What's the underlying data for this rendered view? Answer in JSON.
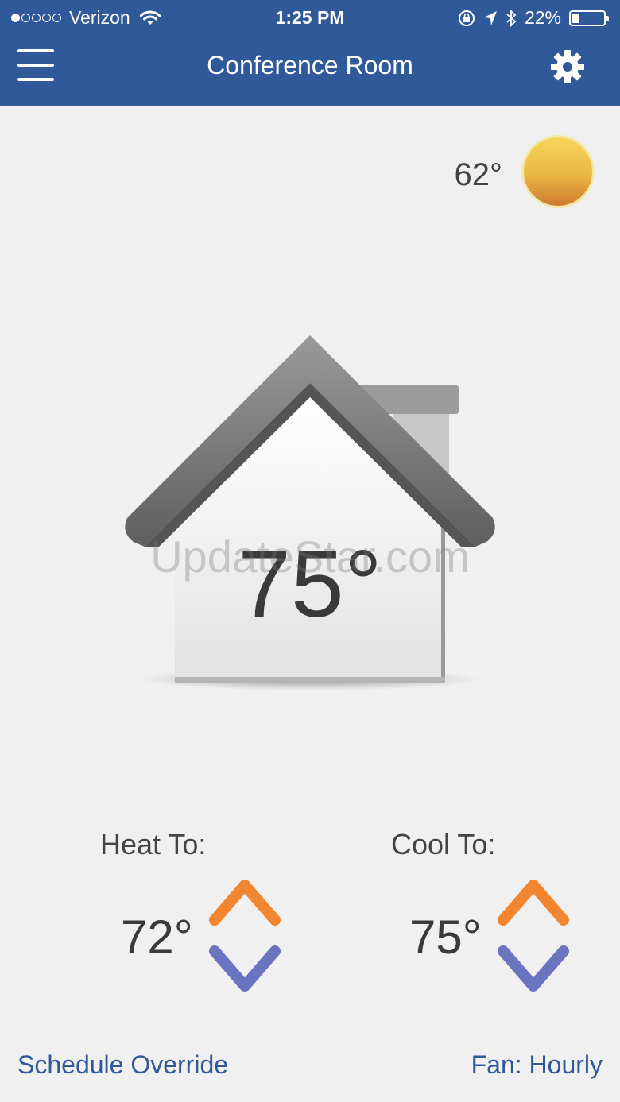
{
  "status_bar": {
    "carrier": "Verizon",
    "time": "1:25 PM",
    "battery": "22%",
    "battery_level": 0.22,
    "icons": [
      "signal-dots",
      "wifi-icon",
      "orientation-lock-icon",
      "location-arrow-icon",
      "bluetooth-icon",
      "battery-icon"
    ]
  },
  "nav": {
    "title": "Conference Room",
    "left_icon": "menu-icon",
    "right_icon": "gear-icon"
  },
  "weather": {
    "outdoor_temp": "62°",
    "icon": "sun-icon"
  },
  "indoor": {
    "temp": "75°",
    "icon": "house-icon"
  },
  "watermark": "UpdateStar.com",
  "heat": {
    "label": "Heat To:",
    "value": "72°"
  },
  "cool": {
    "label": "Cool To:",
    "value": "75°"
  },
  "footer": {
    "schedule_label": "Schedule Override",
    "fan_label": "Fan: Hourly"
  },
  "colors": {
    "header": "#2f5998",
    "up_arrow": "#f28630",
    "down_arrow": "#6b74c0",
    "link": "#2f5998",
    "background": "#f0f0f0"
  }
}
